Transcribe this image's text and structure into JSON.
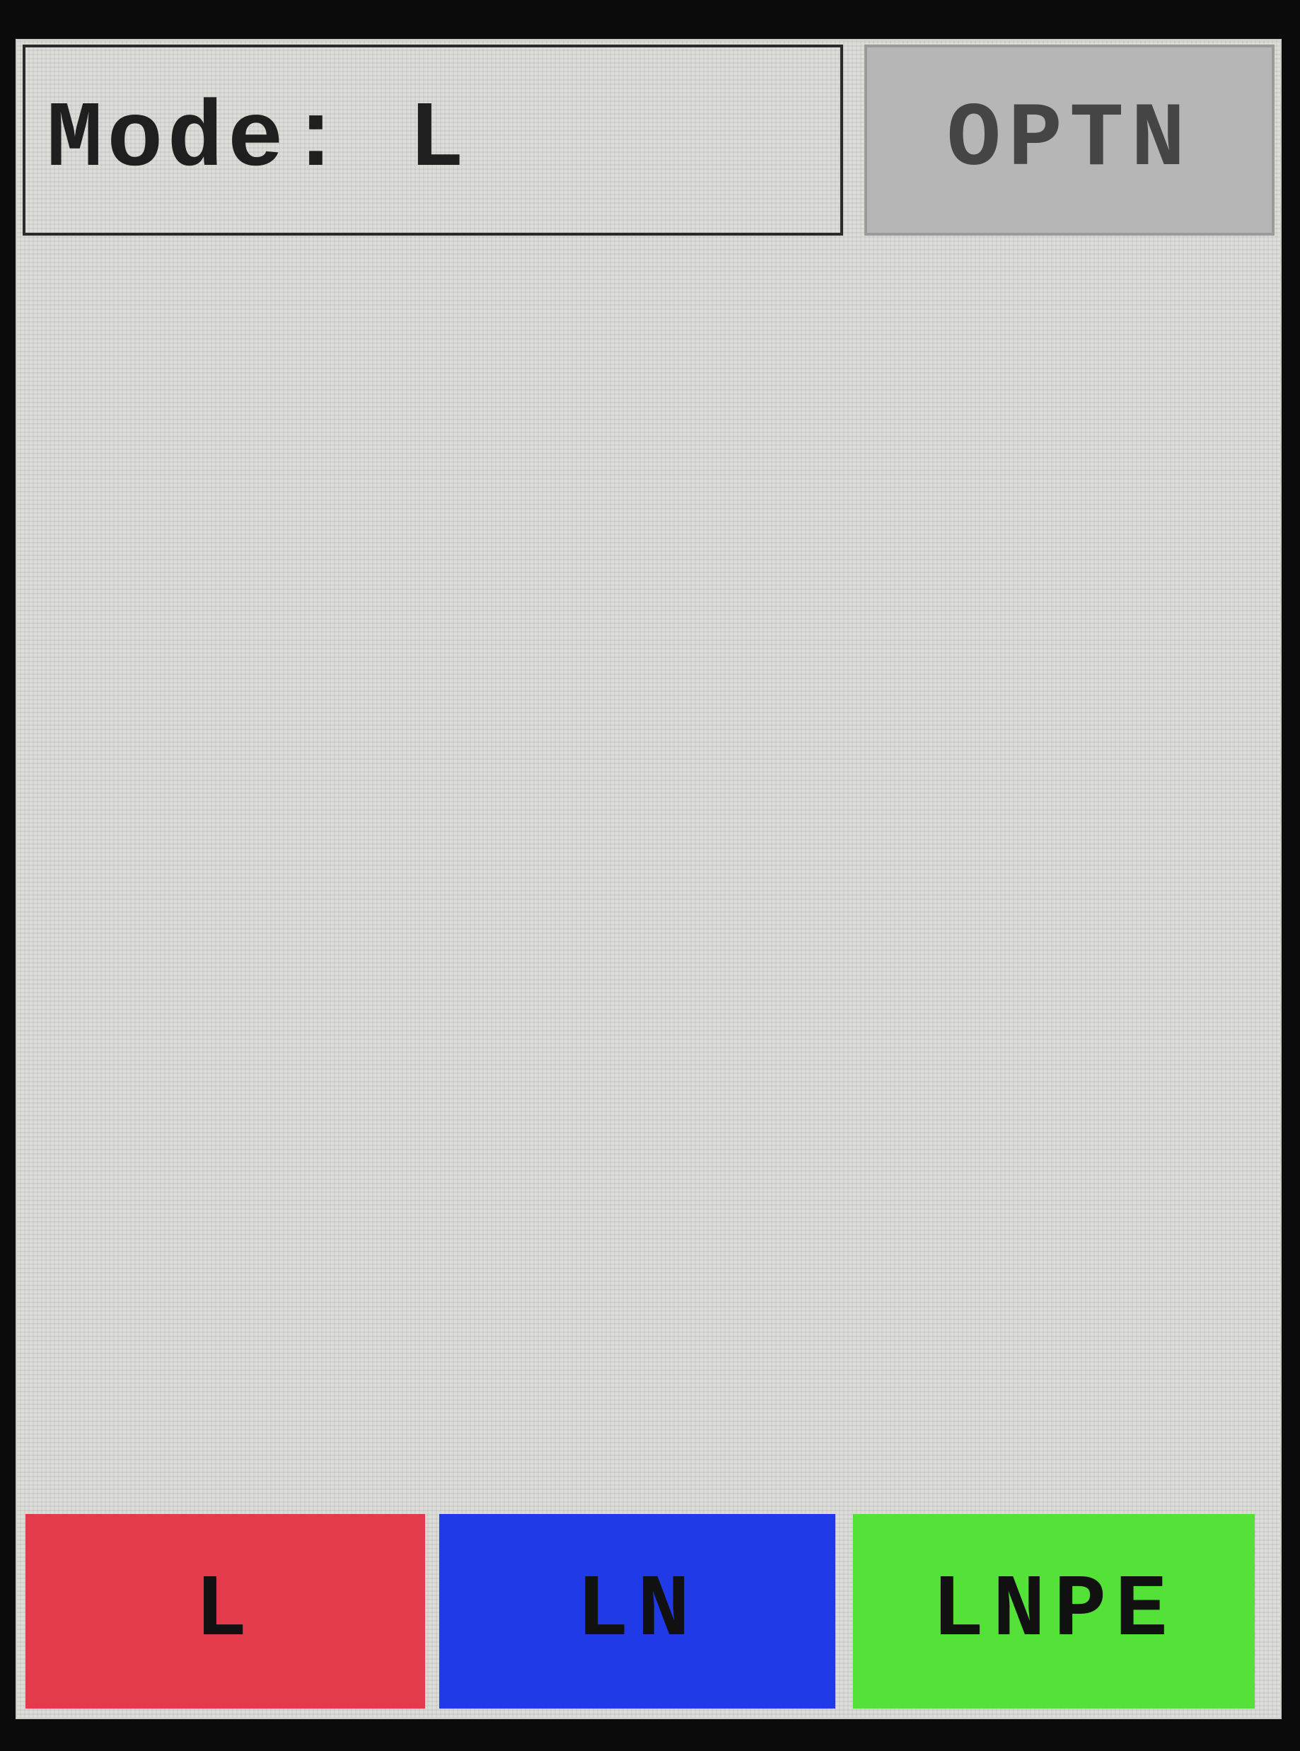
{
  "header": {
    "mode_text": "Mode: L",
    "option_button_label": "OPTN"
  },
  "mode_buttons": [
    {
      "label": "L",
      "color": "#e33a4c"
    },
    {
      "label": "LN",
      "color": "#1f3ae6"
    },
    {
      "label": "LNPE",
      "color": "#55e238"
    }
  ],
  "colors": {
    "screen_background": "#dcdcd8",
    "bezel": "#0b0b0b",
    "option_button": "#b6b6b6"
  }
}
